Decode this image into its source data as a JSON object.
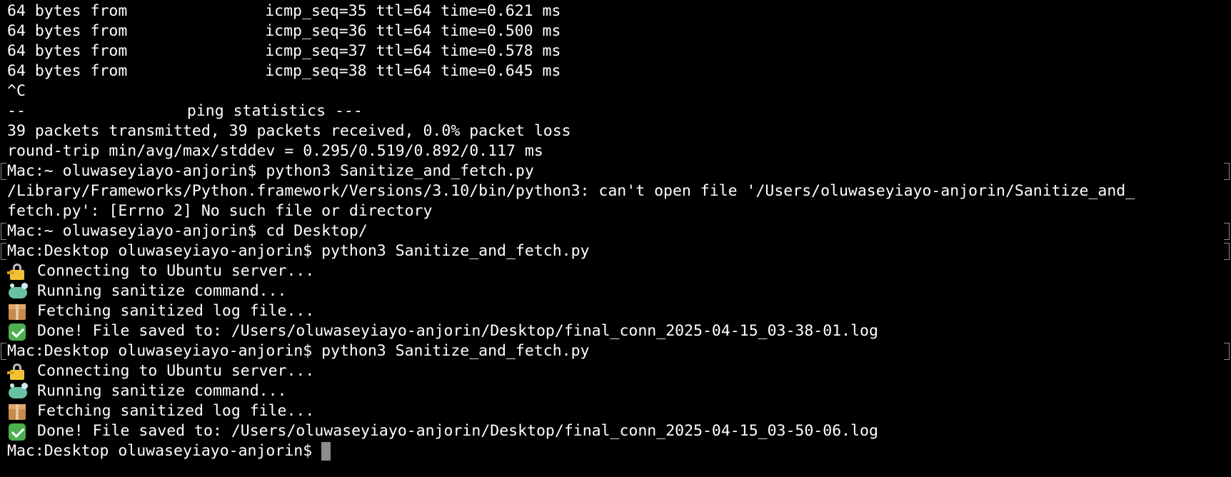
{
  "terminal": {
    "ping_lines": [
      {
        "prefix": "64 bytes from ",
        "suffix": "icmp_seq=35 ttl=64 time=0.621 ms"
      },
      {
        "prefix": "64 bytes from ",
        "suffix": "icmp_seq=36 ttl=64 time=0.500 ms"
      },
      {
        "prefix": "64 bytes from ",
        "suffix": "icmp_seq=37 ttl=64 time=0.578 ms"
      },
      {
        "prefix": "64 bytes from ",
        "suffix": "icmp_seq=38 ttl=64 time=0.645 ms"
      }
    ],
    "interrupt": "^C",
    "stats_prefix": "--",
    "stats_suffix": "ping statistics ---",
    "packets_line": "39 packets transmitted, 39 packets received, 0.0% packet loss",
    "rtt_line": "round-trip min/avg/max/stddev = 0.295/0.519/0.892/0.117 ms",
    "cmd1": "Mac:~ oluwaseyiayo-anjorin$ python3 Sanitize_and_fetch.py",
    "error_line1": "/Library/Frameworks/Python.framework/Versions/3.10/bin/python3: can't open file '/Users/oluwaseyiayo-anjorin/Sanitize_and_",
    "error_line2": "fetch.py': [Errno 2] No such file or directory",
    "cmd2": "Mac:~ oluwaseyiayo-anjorin$ cd Desktop/",
    "run1": {
      "cmd": "Mac:Desktop oluwaseyiayo-anjorin$ python3 Sanitize_and_fetch.py",
      "connecting": "Connecting to Ubuntu server...",
      "running": "Running sanitize command...",
      "fetching": "Fetching sanitized log file...",
      "done": "Done! File saved to: /Users/oluwaseyiayo-anjorin/Desktop/final_conn_2025-04-15_03-38-01.log"
    },
    "run2": {
      "cmd": "Mac:Desktop oluwaseyiayo-anjorin$ python3 Sanitize_and_fetch.py",
      "connecting": "Connecting to Ubuntu server...",
      "running": "Running sanitize command...",
      "fetching": "Fetching sanitized log file...",
      "done": "Done! File saved to: /Users/oluwaseyiayo-anjorin/Desktop/final_conn_2025-04-15_03-50-06.log"
    },
    "prompt": "Mac:Desktop oluwaseyiayo-anjorin$ ",
    "icons": {
      "connecting": "locked-with-key-icon",
      "running": "soap-icon",
      "fetching": "package-icon",
      "done": "check-mark-button-icon"
    },
    "colors": {
      "background": "#000000",
      "text": "#ffffff",
      "cursor": "#8c8c8c"
    }
  }
}
